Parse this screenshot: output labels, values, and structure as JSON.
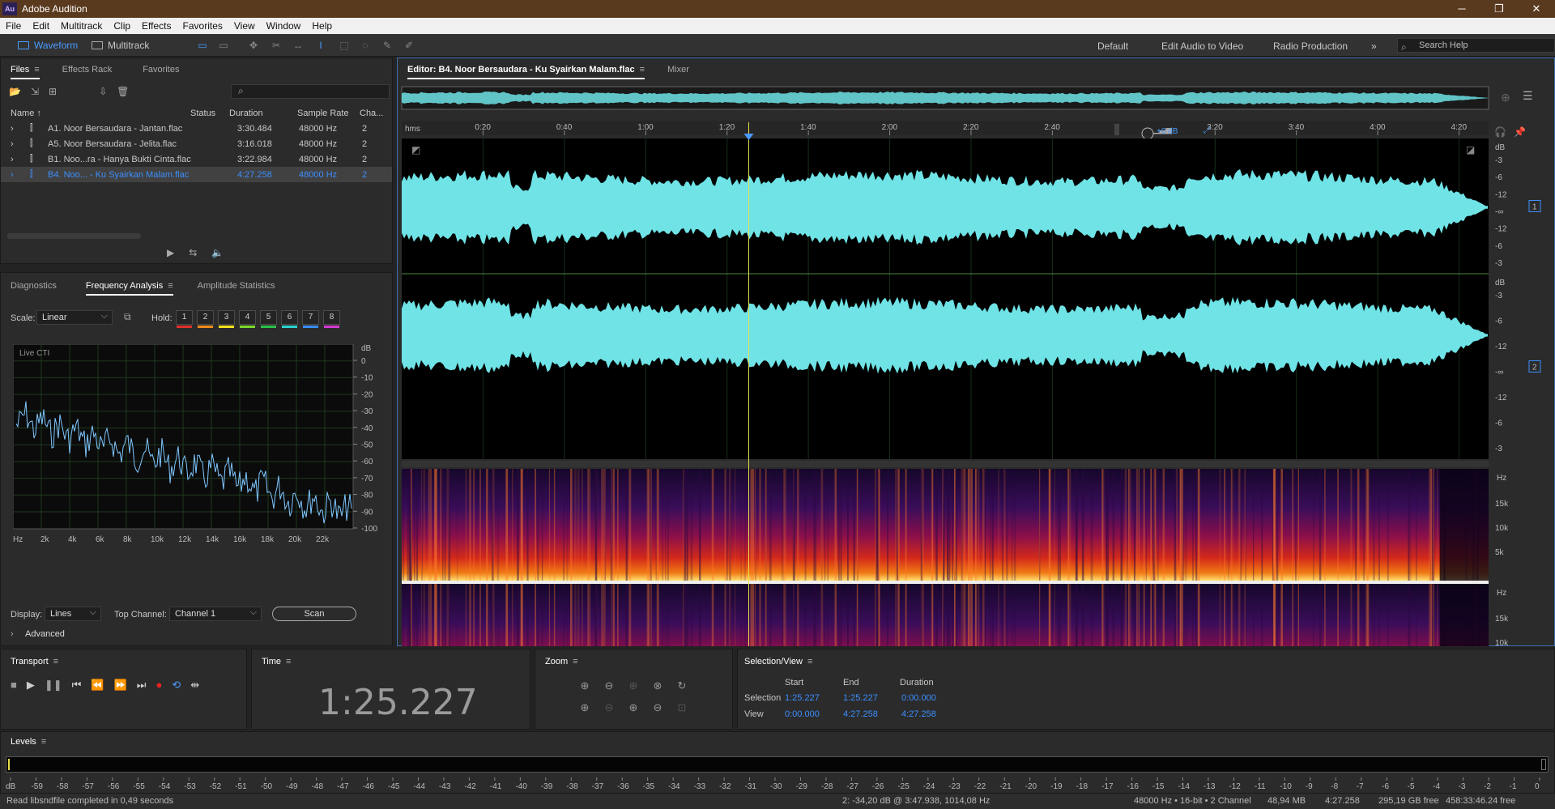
{
  "app": {
    "title": "Adobe Audition",
    "logo": "Au"
  },
  "menu": [
    "File",
    "Edit",
    "Multitrack",
    "Clip",
    "Effects",
    "Favorites",
    "View",
    "Window",
    "Help"
  ],
  "toolbar": {
    "waveform": "Waveform",
    "multitrack": "Multitrack",
    "workspaces": [
      "Default",
      "Edit Audio to Video",
      "Radio Production"
    ],
    "more": "»",
    "search_placeholder": "Search Help"
  },
  "files_panel": {
    "tabs": [
      "Files",
      "Effects Rack",
      "Favorites"
    ],
    "search_icon": "⌕",
    "columns": [
      "Name ↑",
      "Status",
      "Duration",
      "Sample Rate",
      "Cha..."
    ],
    "rows": [
      {
        "name": "A1. Noor Bersaudara - Jantan.flac",
        "duration": "3:30.484",
        "rate": "48000 Hz",
        "ch": "2"
      },
      {
        "name": "A5. Noor Bersaudara - Jelita.flac",
        "duration": "3:16.018",
        "rate": "48000 Hz",
        "ch": "2"
      },
      {
        "name": "B1. Noo...ra - Hanya Bukti Cinta.flac",
        "duration": "3:22.984",
        "rate": "48000 Hz",
        "ch": "2"
      },
      {
        "name": "B4. Noo... - Ku Syairkan Malam.flac",
        "duration": "4:27.258",
        "rate": "48000 Hz",
        "ch": "2"
      }
    ]
  },
  "analysis_panel": {
    "tabs": [
      "Diagnostics",
      "Frequency Analysis",
      "Amplitude Statistics"
    ],
    "scale_label": "Scale:",
    "scale_value": "Linear",
    "hold_label": "Hold:",
    "hold_buttons": [
      "1",
      "2",
      "3",
      "4",
      "5",
      "6",
      "7",
      "8"
    ],
    "hold_colors": [
      "#e0302a",
      "#f08a1c",
      "#f2e21c",
      "#7ad92b",
      "#2bc24a",
      "#2bd2d2",
      "#3a8ef5",
      "#d23ad2"
    ],
    "graph_label": "Live CTI",
    "db_unit": "dB",
    "db_ticks": [
      "0",
      "-10",
      "-20",
      "-30",
      "-40",
      "-50",
      "-60",
      "-70",
      "-80",
      "-90",
      "-100"
    ],
    "hz_ticks": [
      "Hz",
      "2k",
      "4k",
      "6k",
      "8k",
      "10k",
      "12k",
      "14k",
      "16k",
      "18k",
      "20k",
      "22k"
    ],
    "display_label": "Display:",
    "display_value": "Lines",
    "top_channel_label": "Top Channel:",
    "top_channel_value": "Channel 1",
    "scan_label": "Scan",
    "advanced_label": "Advanced"
  },
  "editor": {
    "tab_label": "Editor: B4. Noor Bersaudara - Ku Syairkan Malam.flac",
    "mixer_label": "Mixer",
    "time_unit": "hms",
    "ruler_ticks": [
      "0:20",
      "0:40",
      "1:00",
      "1:20",
      "1:40",
      "2:00",
      "2:20",
      "2:40",
      "3:20",
      "3:40",
      "4:00",
      "4:20"
    ],
    "hud_gain": "+0 dB",
    "db_unit": "dB",
    "channel_db_ticks": [
      "-3",
      "-6",
      "-12",
      "-∞",
      "-12",
      "-6",
      "-3"
    ],
    "channels": [
      "1",
      "2"
    ],
    "hz_unit": "Hz",
    "spec_ticks": [
      "15k",
      "10k",
      "5k"
    ],
    "playhead_fraction": 0.3193,
    "waveform_color": "#6fe3e6"
  },
  "transport": {
    "title": "Transport"
  },
  "time_panel": {
    "title": "Time",
    "value": "1:25.227"
  },
  "zoom": {
    "title": "Zoom"
  },
  "selection": {
    "title": "Selection/View",
    "headers": [
      "Start",
      "End",
      "Duration"
    ],
    "rows": [
      {
        "label": "Selection",
        "start": "1:25.227",
        "end": "1:25.227",
        "duration": "0:00.000"
      },
      {
        "label": "View",
        "start": "0:00.000",
        "end": "4:27.258",
        "duration": "4:27.258"
      }
    ]
  },
  "levels": {
    "title": "Levels",
    "ticks": [
      "dB",
      "-59",
      "-58",
      "-57",
      "-56",
      "-55",
      "-54",
      "-53",
      "-52",
      "-51",
      "-50",
      "-49",
      "-48",
      "-47",
      "-46",
      "-45",
      "-44",
      "-43",
      "-42",
      "-41",
      "-40",
      "-39",
      "-38",
      "-37",
      "-36",
      "-35",
      "-34",
      "-33",
      "-32",
      "-31",
      "-30",
      "-29",
      "-28",
      "-27",
      "-26",
      "-25",
      "-24",
      "-23",
      "-22",
      "-21",
      "-20",
      "-19",
      "-18",
      "-17",
      "-16",
      "-15",
      "-14",
      "-13",
      "-12",
      "-11",
      "-10",
      "-9",
      "-8",
      "-7",
      "-6",
      "-5",
      "-4",
      "-3",
      "-2",
      "-1",
      "0"
    ]
  },
  "status": {
    "message": "Read libsndfile completed in 0,49 seconds",
    "cursor": "2: -34,20 dB @ 3:47.938, 1014,08 Hz",
    "format": "48000 Hz • 16-bit • 2 Channel",
    "size": "48,94 MB",
    "duration": "4:27.258",
    "free": "295,19 GB free",
    "free_time": "458:33:46.24 free"
  }
}
